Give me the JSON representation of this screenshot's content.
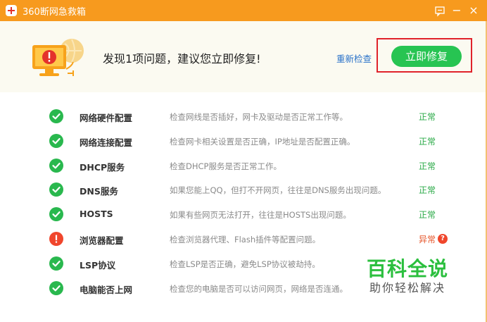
{
  "app": {
    "title": "360断网急救箱",
    "accent_color": "#f79a1e",
    "feedback_icon": "feedback-icon",
    "minimize_symbol": "−",
    "close_symbol": "×"
  },
  "header": {
    "message": "发现1项问题，建议您立即修复!",
    "recheck_label": "重新检查",
    "fix_label": "立即修复",
    "hero_icon": "monitor-error-globe-icon"
  },
  "checks": [
    {
      "name": "网络硬件配置",
      "desc": "检查网线是否插好，网卡及驱动是否正常工作等。",
      "status": "正常",
      "ok": true
    },
    {
      "name": "网络连接配置",
      "desc": "检查网卡相关设置是否正确，IP地址是否配置正确。",
      "status": "正常",
      "ok": true
    },
    {
      "name": "DHCP服务",
      "desc": "检查DHCP服务是否正常工作。",
      "status": "正常",
      "ok": true
    },
    {
      "name": "DNS服务",
      "desc": "如果您能上QQ，但打不开网页，往往是DNS服务出现问题。",
      "status": "正常",
      "ok": true
    },
    {
      "name": "HOSTS",
      "desc": "如果有些网页无法打开，往往是HOSTS出现问题。",
      "status": "正常",
      "ok": true
    },
    {
      "name": "浏览器配置",
      "desc": "检查浏览器代理、Flash插件等配置问题。",
      "status": "异常",
      "ok": false
    },
    {
      "name": "LSP协议",
      "desc": "检查LSP是否正确，避免LSP协议被劫持。",
      "status": "",
      "ok": true
    },
    {
      "name": "电脑能否上网",
      "desc": "检查您的电脑是否可以访问网页，网络是否连通。",
      "status": "",
      "ok": true
    }
  ],
  "watermark": {
    "main": "百科全说",
    "sub": "助你轻松解决"
  }
}
